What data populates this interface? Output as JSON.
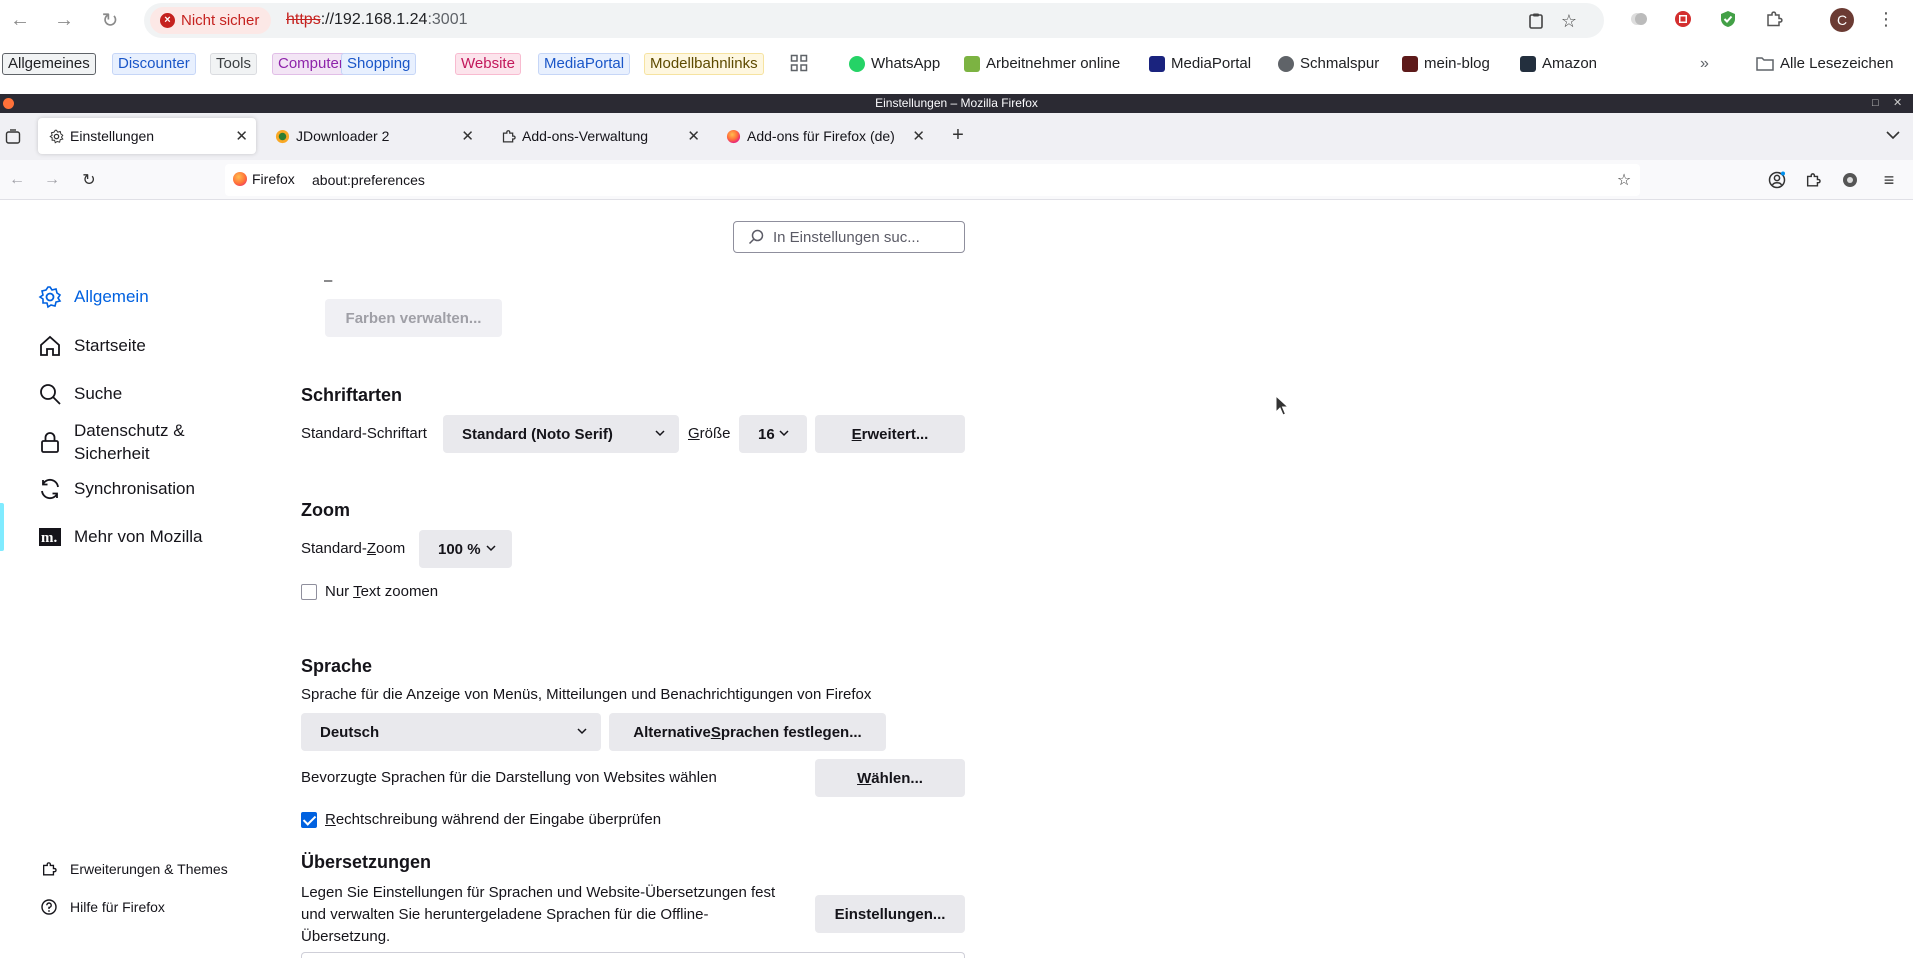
{
  "chrome": {
    "security_chip": "Nicht sicher",
    "url_protocol": "https",
    "url_host": "://192.168.1.24",
    "url_port": ":3001",
    "profile_initial": "C"
  },
  "bookmarks": {
    "chips": [
      {
        "label": "Allgemeines",
        "color": "#202124",
        "bg": "#f1f3f4",
        "border": "#5f6368"
      },
      {
        "label": "Discounter",
        "color": "#1a56c8",
        "bg": "#e8f0fe",
        "border": "#c6d6f7"
      },
      {
        "label": "Tools",
        "color": "#3c4043",
        "bg": "#f1f3f4",
        "border": "#dadce0"
      },
      {
        "label": "Computer",
        "color": "#8e24aa",
        "bg": "#f3e5f5",
        "border": "#e1bee7"
      },
      {
        "label": "Shopping",
        "color": "#1a56c8",
        "bg": "#e8f0fe",
        "border": "#c6d6f7"
      },
      {
        "label": "Website",
        "color": "#c2185b",
        "bg": "#fce4ec",
        "border": "#f8bbd0"
      },
      {
        "label": "MediaPortal",
        "color": "#1a56c8",
        "bg": "#e8f0fe",
        "border": "#c6d6f7"
      },
      {
        "label": "Modellbahnlinks",
        "color": "#5d4a00",
        "bg": "#fef7e0",
        "border": "#f6e3a1"
      }
    ],
    "links": [
      {
        "label": "WhatsApp",
        "icon": "whatsapp-icon"
      },
      {
        "label": "Arbeitnehmer online",
        "icon": "arbeitnehmer-icon"
      },
      {
        "label": "MediaPortal",
        "icon": "mediaportal-icon"
      },
      {
        "label": "Schmalspur",
        "icon": "globe-icon"
      },
      {
        "label": "mein-blog",
        "icon": "blog-icon"
      },
      {
        "label": "Amazon",
        "icon": "amazon-icon"
      }
    ],
    "all_bookmarks": "Alle Lesezeichen"
  },
  "firefox": {
    "window_title": "Einstellungen – Mozilla Firefox",
    "tabs": [
      {
        "label": "Einstellungen",
        "icon": "gear-icon",
        "active": true
      },
      {
        "label": "JDownloader 2",
        "icon": "jdownloader-icon",
        "active": false
      },
      {
        "label": "Add-ons-Verwaltung",
        "icon": "puzzle-icon",
        "active": false
      },
      {
        "label": "Add-ons für Firefox (de)",
        "icon": "firefox-icon",
        "active": false
      }
    ],
    "identity_label": "Firefox",
    "url": "about:preferences"
  },
  "prefs": {
    "search_placeholder": "In Einstellungen suc...",
    "sidebar": [
      {
        "label": "Allgemein",
        "icon": "gear-icon",
        "selected": true
      },
      {
        "label": "Startseite",
        "icon": "home-icon",
        "selected": false
      },
      {
        "label": "Suche",
        "icon": "search-icon",
        "selected": false
      },
      {
        "label": "Datenschutz &",
        "label2": "Sicherheit",
        "icon": "lock-icon",
        "selected": false
      },
      {
        "label": "Synchronisation",
        "icon": "sync-icon",
        "selected": false
      },
      {
        "label": "Mehr von Mozilla",
        "icon": "mozilla-icon",
        "selected": false
      }
    ],
    "sidebar_bottom": [
      {
        "label": "Erweiterungen & Themes",
        "icon": "extensions-icon"
      },
      {
        "label": "Hilfe für Firefox",
        "icon": "help-icon"
      }
    ],
    "colors_dash": "–",
    "manage_colors": "Farben verwalten...",
    "fonts": {
      "heading": "Schriftarten",
      "default_font_label": "Standard-Schriftart",
      "default_font_value": "Standard (Noto Serif)",
      "size_label_prefix": "G",
      "size_label_rest": "röße",
      "size_value": "16",
      "advanced_prefix": "E",
      "advanced_rest": "rweitert..."
    },
    "zoom": {
      "heading": "Zoom",
      "default_zoom_prefix": "Standard-",
      "default_zoom_u": "Z",
      "default_zoom_rest": "oom",
      "zoom_value": "100 %",
      "text_only_prefix": "Nur ",
      "text_only_u": "T",
      "text_only_rest": "ext zoomen",
      "text_only_checked": false
    },
    "language": {
      "heading": "Sprache",
      "description": "Sprache für die Anzeige von Menüs, Mitteilungen und Benachrichtigungen von Firefox",
      "language_value": "Deutsch",
      "alt_languages_prefix": "Alternative ",
      "alt_languages_u": "S",
      "alt_languages_rest": "prachen festlegen...",
      "website_languages_label": "Bevorzugte Sprachen für die Darstellung von Websites wählen",
      "choose_u": "W",
      "choose_rest": "ählen...",
      "spellcheck_prefix": "",
      "spellcheck_u": "R",
      "spellcheck_rest": "echtschreibung während der Eingabe überprüfen",
      "spellcheck_checked": true
    },
    "translations": {
      "heading": "Übersetzungen",
      "line1": "Legen Sie Einstellungen für Sprachen und Website-Übersetzungen fest",
      "line2": "und verwalten Sie heruntergeladene Sprachen für die Offline-",
      "line3": "Übersetzung.",
      "settings_button": "Einstellungen..."
    }
  },
  "colors": {
    "accent": "#0061e0",
    "insecure": "#c5221f",
    "sidebar_indicator": "#80ebff"
  }
}
